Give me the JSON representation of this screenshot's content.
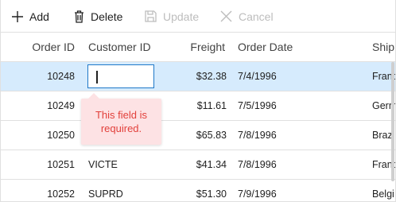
{
  "toolbar": {
    "add_label": "Add",
    "delete_label": "Delete",
    "update_label": "Update",
    "cancel_label": "Cancel"
  },
  "columns": {
    "order_id": "Order ID",
    "customer_id": "Customer ID",
    "freight": "Freight",
    "order_date": "Order Date",
    "ship": "Ship"
  },
  "rows": [
    {
      "order_id": "10248",
      "customer_id": "",
      "freight": "$32.38",
      "order_date": "7/4/1996",
      "ship": "Franc"
    },
    {
      "order_id": "10249",
      "customer_id": "",
      "freight": "$11.61",
      "order_date": "7/5/1996",
      "ship": "Germ"
    },
    {
      "order_id": "10250",
      "customer_id": "",
      "freight": "$65.83",
      "order_date": "7/8/1996",
      "ship": "Brazil"
    },
    {
      "order_id": "10251",
      "customer_id": "VICTE",
      "freight": "$41.34",
      "order_date": "7/8/1996",
      "ship": "Franc"
    },
    {
      "order_id": "10252",
      "customer_id": "SUPRD",
      "freight": "$51.30",
      "order_date": "7/9/1996",
      "ship": "Belgi"
    }
  ],
  "validation": {
    "message_line1": "This field is",
    "message_line2": "required."
  },
  "colors": {
    "editing_row": "#d6ebfd",
    "input_border": "#1f78c8",
    "error_text": "#e2403b",
    "error_bg": "#fde2e4",
    "disabled": "#bdbdbd"
  },
  "icons": {
    "add": "plus-icon",
    "delete": "trash-icon",
    "update": "save-icon",
    "cancel": "close-icon"
  }
}
